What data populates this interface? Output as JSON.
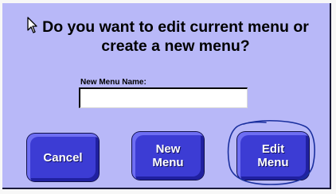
{
  "dialog": {
    "title": "Do you want to edit current menu or\ncreate a new menu?"
  },
  "field": {
    "label": "New Menu Name:",
    "value": ""
  },
  "buttons": {
    "cancel": "Cancel",
    "new_menu": "New\nMenu",
    "edit_menu": "Edit\nMenu"
  },
  "colors": {
    "dialog_bg": "#b8b8f8",
    "button_bg": "#3c3cd4",
    "annotation": "#1a2f9e"
  }
}
